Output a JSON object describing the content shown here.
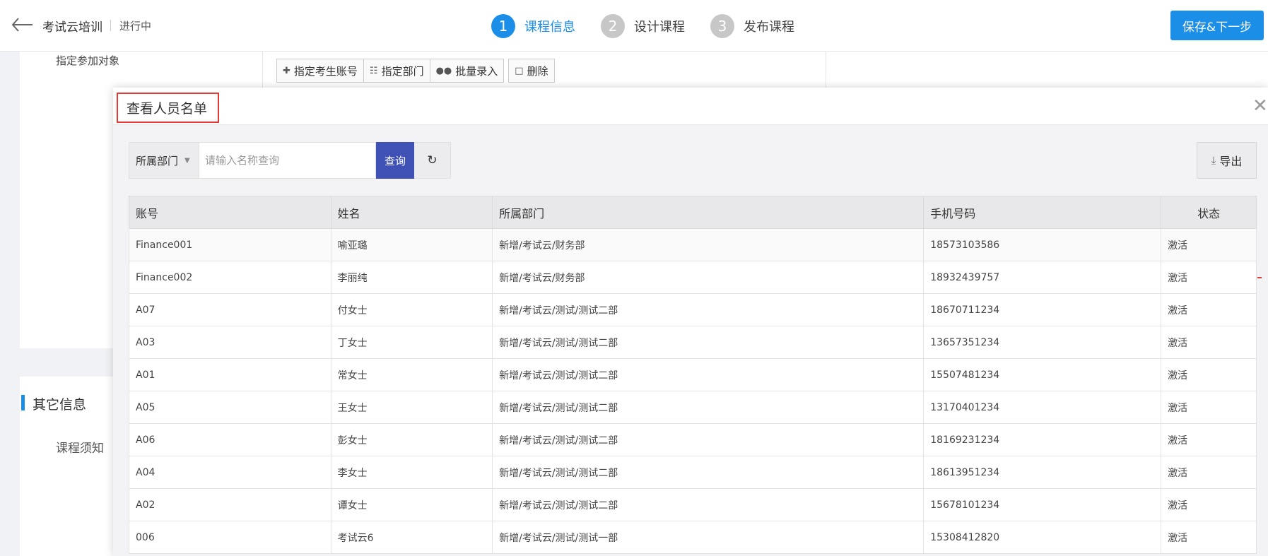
{
  "header": {
    "title": "考试云培训",
    "status": "进行中",
    "steps": [
      {
        "num": "1",
        "label": "课程信息"
      },
      {
        "num": "2",
        "label": "设计课程"
      },
      {
        "num": "3",
        "label": "发布课程"
      }
    ],
    "save_label": "保存&下一步"
  },
  "page": {
    "participants_label": "指定参加对象",
    "toolbar": {
      "assign_account": "指定考生账号",
      "assign_dept": "指定部门",
      "batch_import": "批量录入",
      "delete": "删除"
    },
    "other_info_title": "其它信息",
    "course_notes": "课程须知"
  },
  "modal": {
    "title": "查看人员名单",
    "dept_select": "所属部门",
    "search_placeholder": "请输入名称查询",
    "query_label": "查询",
    "export_label": "导出",
    "columns": {
      "account": "账号",
      "name": "姓名",
      "dept": "所属部门",
      "phone": "手机号码",
      "status": "状态"
    },
    "rows": [
      {
        "account": "Finance001",
        "name": "喻亚璐",
        "dept": "新增/考试云/财务部",
        "phone": "18573103586",
        "status": "激活"
      },
      {
        "account": "Finance002",
        "name": "李丽纯",
        "dept": "新增/考试云/财务部",
        "phone": "18932439757",
        "status": "激活"
      },
      {
        "account": "A07",
        "name": "付女士",
        "dept": "新增/考试云/测试/测试二部",
        "phone": "18670711234",
        "status": "激活"
      },
      {
        "account": "A03",
        "name": "丁女士",
        "dept": "新增/考试云/测试/测试二部",
        "phone": "13657351234",
        "status": "激活"
      },
      {
        "account": "A01",
        "name": "常女士",
        "dept": "新增/考试云/测试/测试二部",
        "phone": "15507481234",
        "status": "激活"
      },
      {
        "account": "A05",
        "name": "王女士",
        "dept": "新增/考试云/测试/测试二部",
        "phone": "13170401234",
        "status": "激活"
      },
      {
        "account": "A06",
        "name": "彭女士",
        "dept": "新增/考试云/测试/测试二部",
        "phone": "18169231234",
        "status": "激活"
      },
      {
        "account": "A04",
        "name": "李女士",
        "dept": "新增/考试云/测试/测试二部",
        "phone": "18613951234",
        "status": "激活"
      },
      {
        "account": "A02",
        "name": "谭女士",
        "dept": "新增/考试云/测试/测试二部",
        "phone": "15678101234",
        "status": "激活"
      },
      {
        "account": "006",
        "name": "考试云6",
        "dept": "新增/考试云/测试/测试一部",
        "phone": "15308412820",
        "status": "激活"
      }
    ]
  },
  "colors": {
    "accent": "#1b8fe8",
    "query_button": "#3f51b5",
    "highlight_border": "#e53935"
  }
}
